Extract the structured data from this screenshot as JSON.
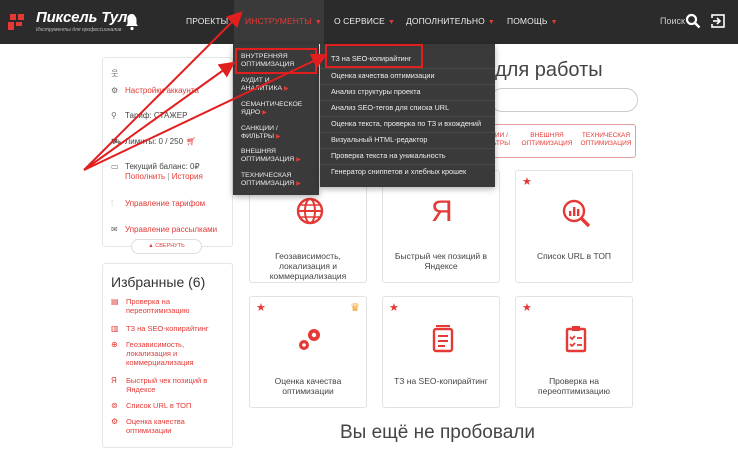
{
  "logo": {
    "name": "Пиксель Тулс",
    "tagline": "Инструменты для профессионалов"
  },
  "nav": {
    "projects": "ПРОЕКТЫ",
    "tools": "ИНСТРУМЕНТЫ",
    "about": "О СЕРВИСЕ",
    "more": "ДОПОЛНИТЕЛЬНО",
    "help": "ПОМОЩЬ",
    "search": "Поиск"
  },
  "sidebar": {
    "account": "Настройки аккаунта",
    "tariff_prefix": "Тариф: СТАЖЕР",
    "limits": "Лимиты: 0 / 250",
    "balance": "Текущий баланс: 0₽",
    "topup": "Пополнить",
    "sep": "|",
    "history": "История",
    "manage_tariff": "Управление тарифом",
    "manage_mailings": "Управление рассылками",
    "collapse": "свернуть"
  },
  "favorites": {
    "title": "Избранные (6)",
    "items": [
      "Проверка на переоптимизацию",
      "ТЗ на SEO-копирайтинг",
      "Геозависимость, локализация и коммерциализация",
      "Быстрый чек позиций в Яндексе",
      "Список URL в ТОП",
      "Оценка качества оптимизации"
    ]
  },
  "main": {
    "title": "для работы",
    "filters": [
      "ЦИИ / ЛЬТРЫ",
      "ВНЕШНЯЯ ОПТИМИЗАЦИЯ",
      "ТЕХНИЧЕСКАЯ ОПТИМИЗАЦИЯ"
    ],
    "cards": [
      "Геозависимость, локализация и коммерциализация",
      "Быстрый чек позиций в Яндексе",
      "Список URL в ТОП",
      "Оценка качества оптимизации",
      "ТЗ на SEO-копирайтинг",
      "Проверка на переоптимизацию"
    ],
    "never_tried": "Вы ещё не пробовали"
  },
  "menu_level1": [
    "ВНУТРЕННЯЯ ОПТИМИЗАЦИЯ",
    "АУДИТ И АНАЛИТИКА",
    "СЕМАНТИЧЕСКОЕ ЯДРО",
    "САНКЦИИ / ФИЛЬТРЫ",
    "ВНЕШНЯЯ ОПТИМИЗАЦИЯ",
    "ТЕХНИЧЕСКАЯ ОПТИМИЗАЦИЯ"
  ],
  "menu_level2": [
    "ТЗ на SEO-копирайтинг",
    "Оценка качества оптимизации",
    "Анализ структуры проекта",
    "Анализ SEO-тегов для списка URL",
    "Оценка текста, проверка по ТЗ и вхождений",
    "Визуальный HTML-редактор",
    "Проверка текста на уникальность",
    "Генератор сниппетов и хлебных крошек"
  ],
  "colors": {
    "accent": "#e53935",
    "nav_bg": "#2b2b2b",
    "menu_bg": "#3a3a3a",
    "annotation": "#e21f1f"
  }
}
